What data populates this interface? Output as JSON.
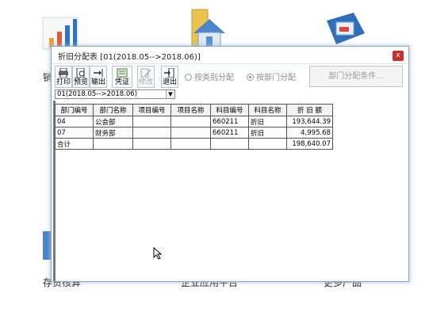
{
  "desktop": {
    "icons": [
      {
        "name": "chart-icon",
        "label": "销"
      },
      {
        "name": "house-icon",
        "label": ""
      },
      {
        "name": "monitor-icon",
        "label": ""
      },
      {
        "name": "inventory-icon",
        "label": "存货核算"
      },
      {
        "name": "platform-icon",
        "label": "企业应用平台"
      },
      {
        "name": "more-products-icon",
        "label": "更多产品"
      }
    ]
  },
  "dialog": {
    "title": "折旧分配表 [01(2018.05-->2018.06)]",
    "close_label": "x",
    "toolbar": {
      "print": "打印",
      "preview": "预览",
      "export": "输出",
      "voucher": "凭证",
      "modify": "修改",
      "exit": "退出"
    },
    "radio_by_category": "按类别分配",
    "radio_by_department": "按部门分配",
    "dept_condition_button": "部门分配条件...",
    "period_value": "01(2018.05-->2018.06)",
    "table": {
      "headers": [
        "部门编号",
        "部门名称",
        "项目编号",
        "项目名称",
        "科目编号",
        "科目名称",
        "折 旧 额"
      ],
      "rows": [
        [
          "04",
          "公会部",
          "",
          "",
          "660211",
          "折旧",
          "193,644.39"
        ],
        [
          "07",
          "财务部",
          "",
          "",
          "660211",
          "折旧",
          "4,995.68"
        ],
        [
          "合计",
          "",
          "",
          "",
          "",
          "",
          "198,640.07"
        ]
      ]
    }
  },
  "colors": {
    "dialog_border": "#8aa6c9",
    "close_button": "#c9302c"
  }
}
